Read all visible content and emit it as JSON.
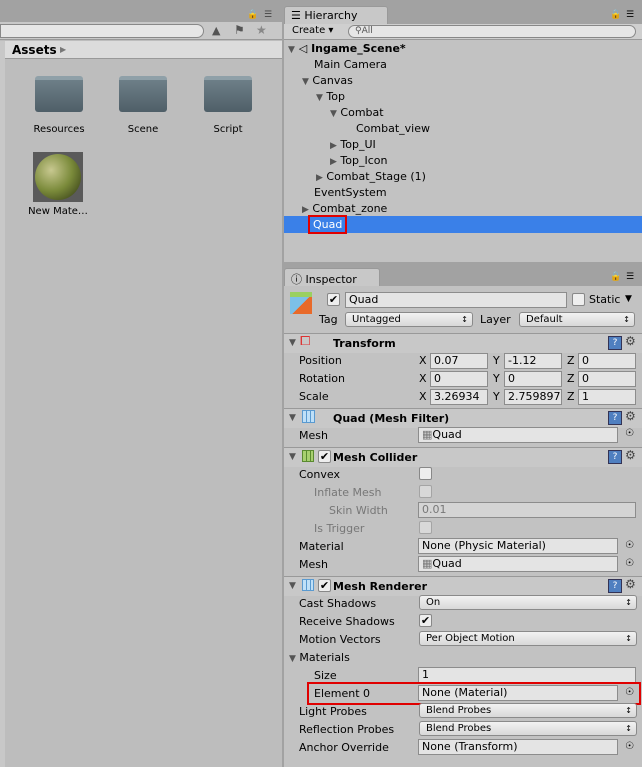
{
  "project": {
    "breadcrumb": "Assets",
    "items": [
      {
        "label": "Resources",
        "type": "folder"
      },
      {
        "label": "Scene",
        "type": "folder"
      },
      {
        "label": "Script",
        "type": "folder"
      },
      {
        "label": "New Mate…",
        "type": "material"
      }
    ]
  },
  "hierarchy": {
    "tab": "Hierarchy",
    "create": "Create ▾",
    "search_placeholder": "All",
    "scene": "Ingame_Scene*",
    "rows": [
      {
        "label": "Main Camera",
        "depth": 1
      },
      {
        "label": "Canvas",
        "depth": 1,
        "open": true
      },
      {
        "label": "Top",
        "depth": 2,
        "open": true
      },
      {
        "label": "Combat",
        "depth": 3,
        "open": true
      },
      {
        "label": "Combat_view",
        "depth": 4
      },
      {
        "label": "Top_UI",
        "depth": 3,
        "closed": true
      },
      {
        "label": "Top_Icon",
        "depth": 3,
        "closed": true
      },
      {
        "label": "Combat_Stage (1)",
        "depth": 2,
        "closed": true
      },
      {
        "label": "EventSystem",
        "depth": 1
      },
      {
        "label": "Combat_zone",
        "depth": 1,
        "closed": true
      },
      {
        "label": "Quad",
        "depth": 1,
        "selected": true
      }
    ]
  },
  "inspector": {
    "tab": "Inspector",
    "name": "Quad",
    "static": "Static",
    "tag_label": "Tag",
    "tag": "Untagged",
    "layer_label": "Layer",
    "layer": "Default",
    "transform": {
      "title": "Transform",
      "rows": [
        {
          "label": "Position",
          "x": "0.07",
          "y": "-1.12",
          "z": "0"
        },
        {
          "label": "Rotation",
          "x": "0",
          "y": "0",
          "z": "0"
        },
        {
          "label": "Scale",
          "x": "3.26934",
          "y": "2.759897",
          "z": "1"
        }
      ]
    },
    "mesh_filter": {
      "title": "Quad (Mesh Filter)",
      "mesh_label": "Mesh",
      "mesh": "Quad"
    },
    "collider": {
      "title": "Mesh Collider",
      "convex": "Convex",
      "inflate": "Inflate Mesh",
      "skin": "Skin Width",
      "skin_value": "0.01",
      "trigger": "Is Trigger",
      "material_label": "Material",
      "material": "None (Physic Material)",
      "mesh_label": "Mesh",
      "mesh": "Quad"
    },
    "renderer": {
      "title": "Mesh Renderer",
      "cast_label": "Cast Shadows",
      "cast": "On",
      "receive_label": "Receive Shadows",
      "motion_label": "Motion Vectors",
      "motion": "Per Object Motion",
      "materials": "Materials",
      "size_label": "Size",
      "size": "1",
      "element_label": "Element 0",
      "element": "None (Material)",
      "light_label": "Light Probes",
      "light": "Blend Probes",
      "refl_label": "Reflection Probes",
      "refl": "Blend Probes",
      "anchor_label": "Anchor Override",
      "anchor": "None (Transform)"
    }
  },
  "colors": {
    "selection": "#3a80e8",
    "highlight": "#e00000"
  }
}
